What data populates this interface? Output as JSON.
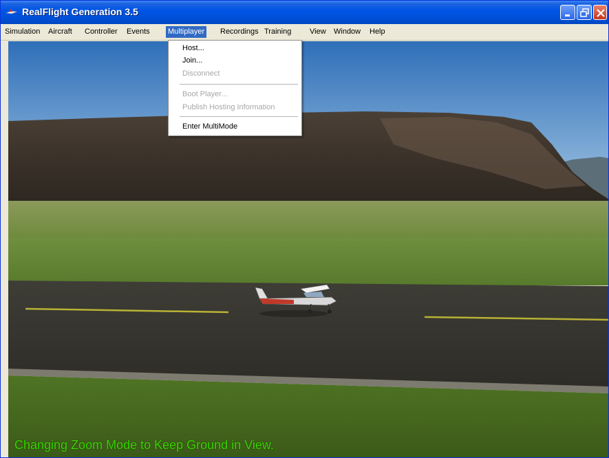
{
  "window": {
    "title": "RealFlight Generation 3.5",
    "controls": [
      "minimize-icon",
      "restore-icon",
      "close-icon"
    ]
  },
  "menubar": {
    "items": [
      {
        "label": "Simulation"
      },
      {
        "label": "Aircraft"
      },
      {
        "label": "Controller"
      },
      {
        "label": "Events"
      },
      {
        "label": "Multiplayer",
        "active": true
      },
      {
        "label": "Recordings"
      },
      {
        "label": "Training"
      },
      {
        "label": "View"
      },
      {
        "label": "Window"
      },
      {
        "label": "Help"
      }
    ]
  },
  "multiplayer_menu": {
    "items": [
      {
        "label": "Host...",
        "enabled": true
      },
      {
        "label": "Join...",
        "enabled": true
      },
      {
        "label": "Disconnect",
        "enabled": false
      },
      {
        "label": "Boot Player...",
        "enabled": false
      },
      {
        "label": "Publish Hosting Information",
        "enabled": false
      },
      {
        "label": "Enter MultiMode",
        "enabled": true
      }
    ]
  },
  "status_message": "Changing Zoom Mode to Keep Ground in View.",
  "colors": {
    "titlebar": "#0055e5",
    "menu_highlight": "#316ac5",
    "status_text": "#3cd800"
  }
}
